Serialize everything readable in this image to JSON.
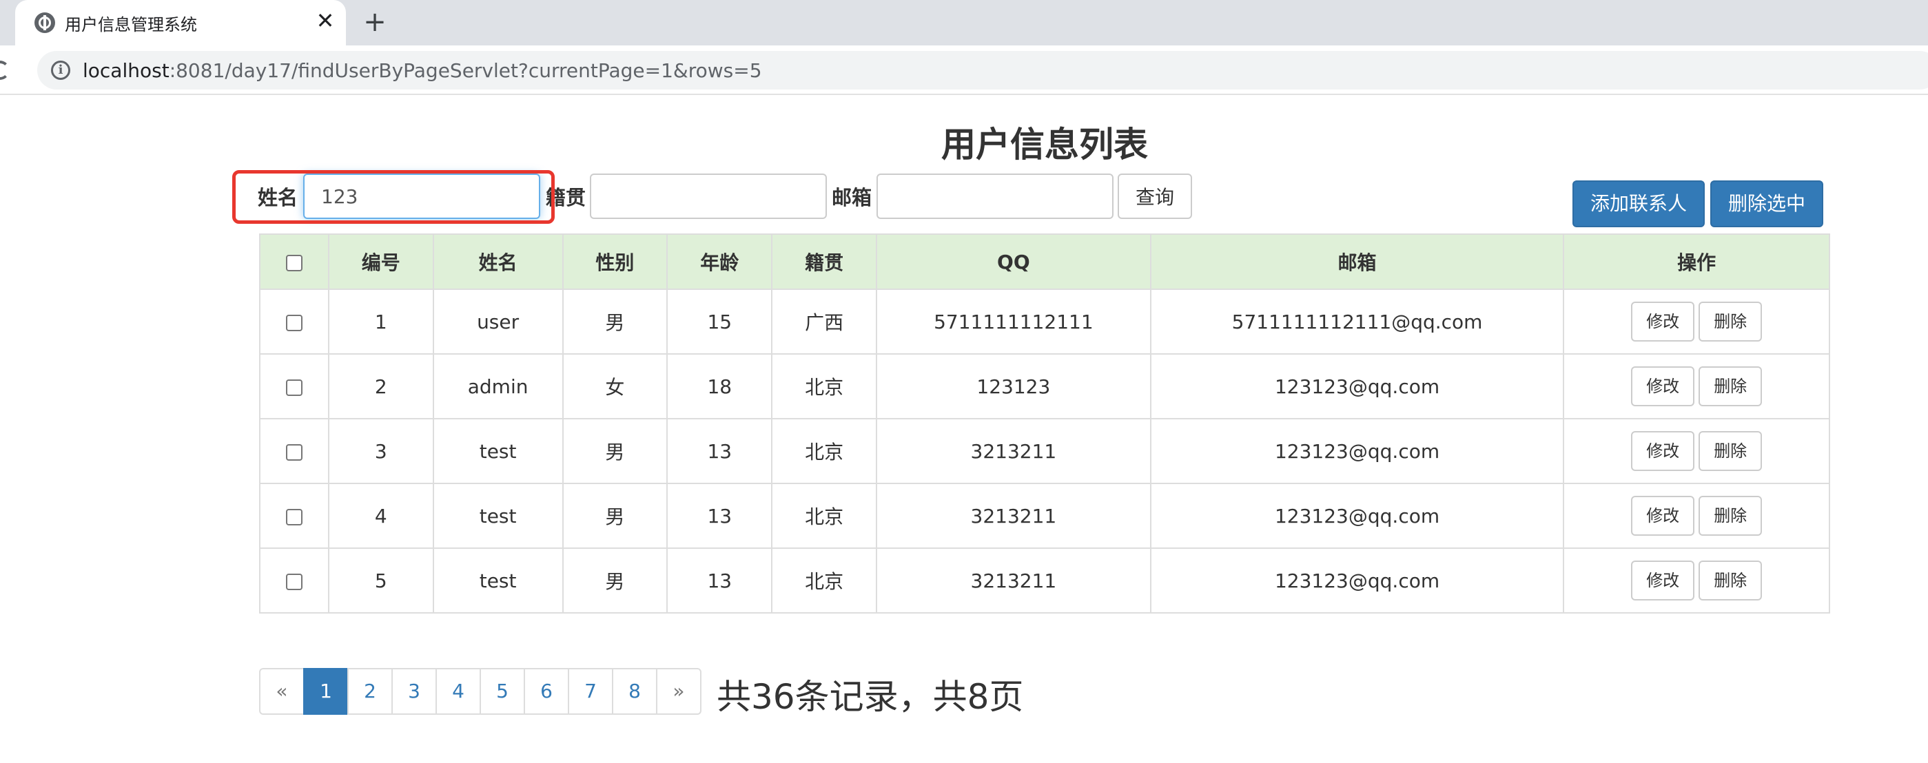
{
  "browser": {
    "tab_title": "用户信息管理系统",
    "tab_close": "✕",
    "new_tab": "+",
    "url_host": "localhost",
    "url_rest": ":8081/day17/findUserByPageServlet?currentPage=1&rows=5"
  },
  "page": {
    "title": "用户信息列表"
  },
  "search": {
    "name_label": "姓名",
    "name_value": "123",
    "address_label": "籍贯",
    "address_value": "",
    "email_label": "邮箱",
    "email_value": "",
    "query_button": "查询"
  },
  "actions": {
    "add_button": "添加联系人",
    "delete_selected_button": "删除选中"
  },
  "table": {
    "headers": [
      "编号",
      "姓名",
      "性别",
      "年龄",
      "籍贯",
      "QQ",
      "邮箱",
      "操作"
    ],
    "edit_label": "修改",
    "delete_label": "删除",
    "rows": [
      {
        "id": "1",
        "name": "user",
        "gender": "男",
        "age": "15",
        "address": "广西",
        "qq": "5711111112111",
        "email": "5711111112111@qq.com"
      },
      {
        "id": "2",
        "name": "admin",
        "gender": "女",
        "age": "18",
        "address": "北京",
        "qq": "123123",
        "email": "123123@qq.com"
      },
      {
        "id": "3",
        "name": "test",
        "gender": "男",
        "age": "13",
        "address": "北京",
        "qq": "3213211",
        "email": "123123@qq.com"
      },
      {
        "id": "4",
        "name": "test",
        "gender": "男",
        "age": "13",
        "address": "北京",
        "qq": "3213211",
        "email": "123123@qq.com"
      },
      {
        "id": "5",
        "name": "test",
        "gender": "男",
        "age": "13",
        "address": "北京",
        "qq": "3213211",
        "email": "123123@qq.com"
      }
    ]
  },
  "pagination": {
    "prev": "«",
    "next": "»",
    "pages": [
      "1",
      "2",
      "3",
      "4",
      "5",
      "6",
      "7",
      "8"
    ],
    "current": "1",
    "summary": "共36条记录，共8页"
  },
  "colors": {
    "primary": "#337ab7",
    "header_bg": "#dff0d8",
    "highlight_border": "#e8372e"
  }
}
